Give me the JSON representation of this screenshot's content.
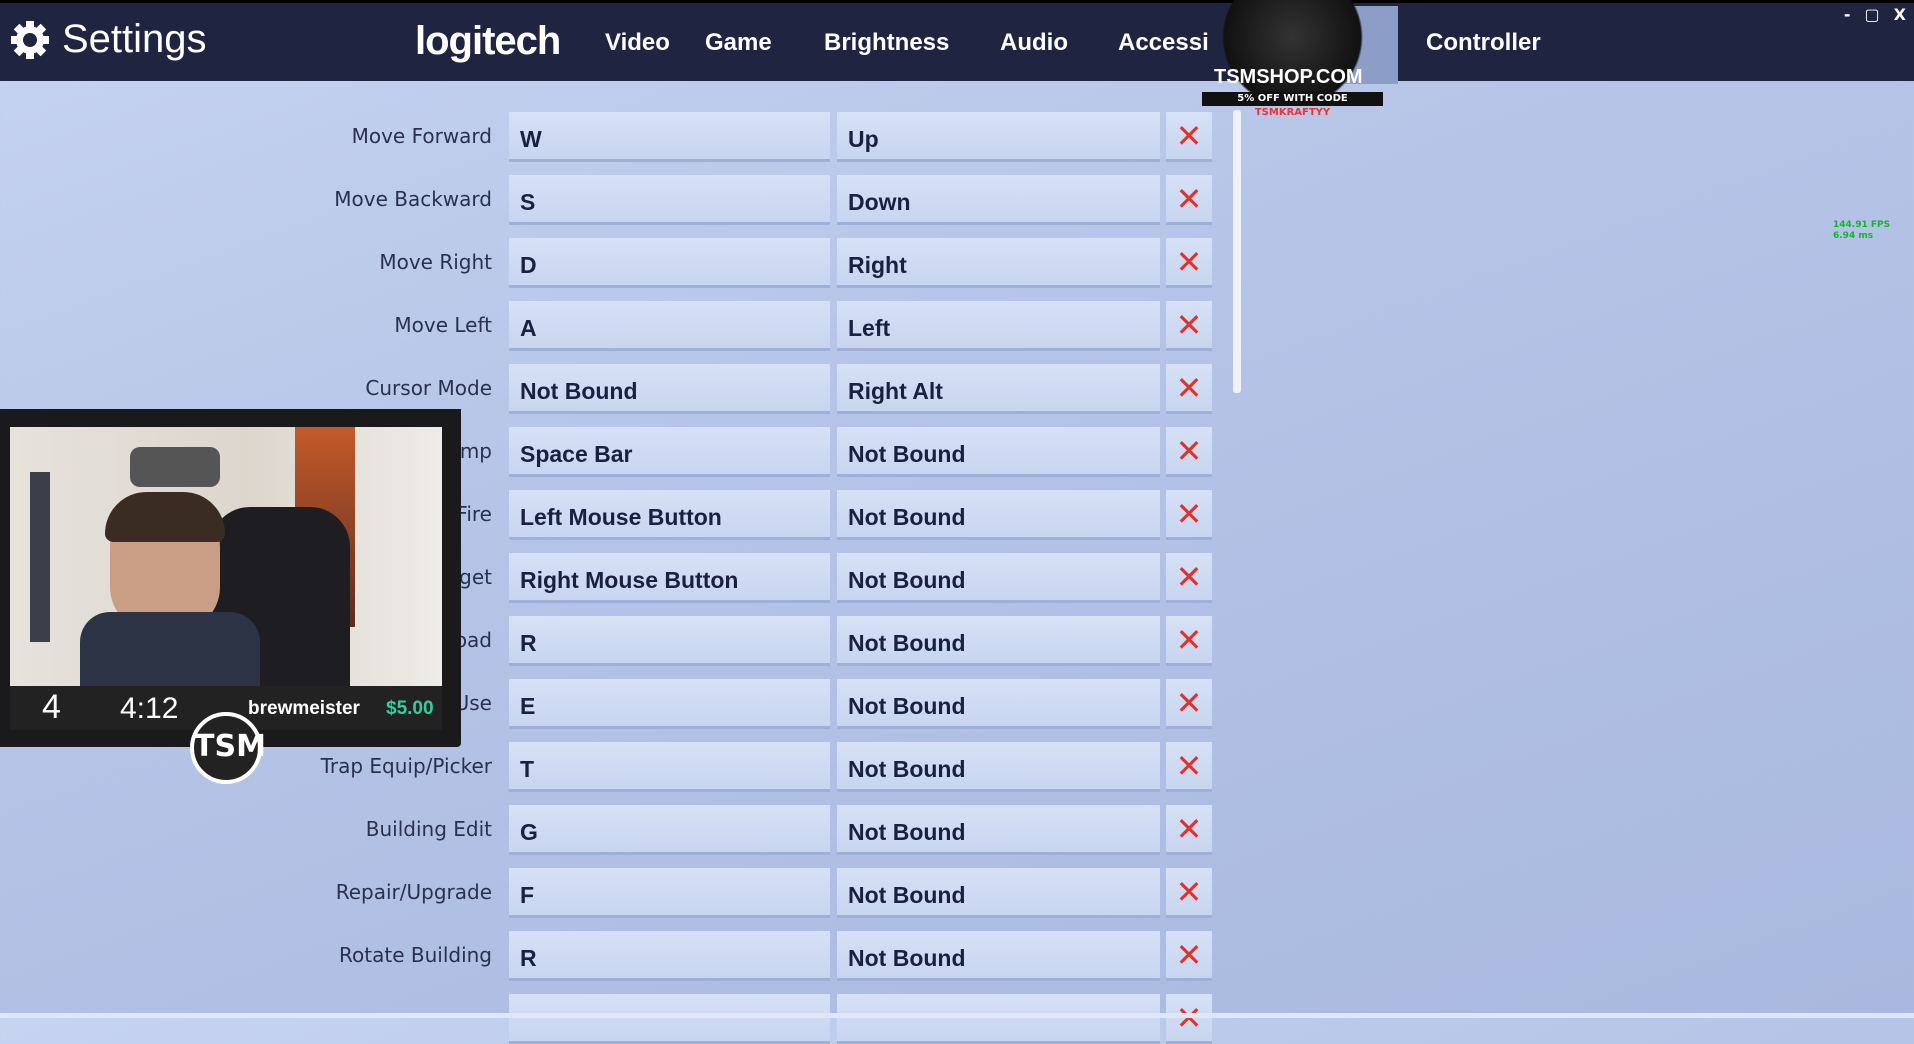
{
  "header": {
    "title": "Settings",
    "sponsor_logo": "logitech",
    "tabs": [
      "Video",
      "Game",
      "Brightness",
      "Audio",
      "Accessibility",
      "Controller"
    ],
    "window_controls": [
      "-",
      "▢",
      "X"
    ]
  },
  "ad": {
    "site": "TSMSHOP.COM",
    "code_text": "5% OFF WITH CODE",
    "code": "TSMKRAFTYY"
  },
  "bindings": [
    {
      "action": "Move Forward",
      "primary": "W",
      "secondary": "Up"
    },
    {
      "action": "Move Backward",
      "primary": "S",
      "secondary": "Down"
    },
    {
      "action": "Move Right",
      "primary": "D",
      "secondary": "Right"
    },
    {
      "action": "Move Left",
      "primary": "A",
      "secondary": "Left"
    },
    {
      "action": "Cursor Mode",
      "primary": "Not Bound",
      "secondary": "Right Alt"
    },
    {
      "action": "mp",
      "primary": "Space Bar",
      "secondary": "Not Bound"
    },
    {
      "action": "Fire",
      "primary": "Left Mouse Button",
      "secondary": "Not Bound"
    },
    {
      "action": "get",
      "primary": "Right Mouse Button",
      "secondary": "Not Bound"
    },
    {
      "action": "oad",
      "primary": "R",
      "secondary": "Not Bound"
    },
    {
      "action": "Use",
      "primary": "E",
      "secondary": "Not Bound"
    },
    {
      "action": "Trap Equip/Picker",
      "primary": "T",
      "secondary": "Not Bound"
    },
    {
      "action": "Building Edit",
      "primary": "G",
      "secondary": "Not Bound"
    },
    {
      "action": "Repair/Upgrade",
      "primary": "F",
      "secondary": "Not Bound"
    },
    {
      "action": "Rotate Building",
      "primary": "R",
      "secondary": "Not Bound"
    },
    {
      "action": "",
      "primary": "",
      "secondary": ""
    }
  ],
  "clear_symbol": "✕",
  "overlay": {
    "fps": "144.91 FPS",
    "ms": "6.94 ms",
    "count": "4",
    "timer": "4:12",
    "donor": "brewmeister",
    "amount": "$5.00",
    "logo": "TSM"
  },
  "colors": {
    "topbar": "#1f2540",
    "clear": "#e0332b",
    "donation": "#2fd0a0",
    "fps": "#16b32d"
  }
}
